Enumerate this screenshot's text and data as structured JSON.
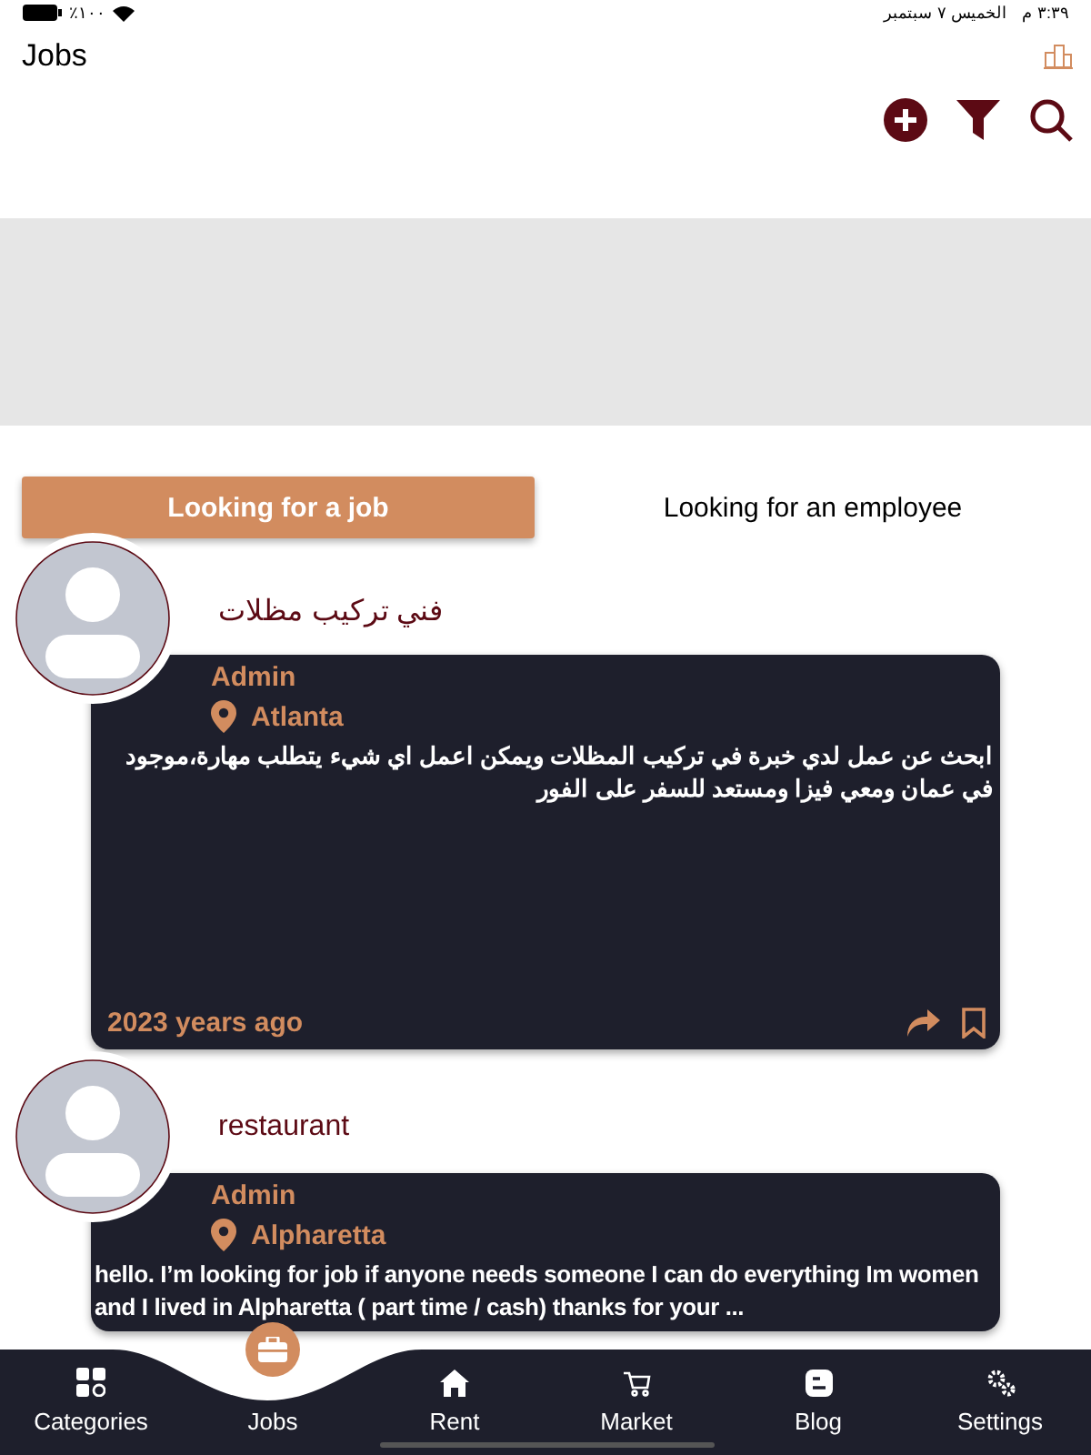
{
  "status_bar": {
    "battery": "٪١٠٠",
    "time": "٣:٣٩ م",
    "date": "الخميس ٧ سبتمبر"
  },
  "header": {
    "title": "Jobs"
  },
  "tabs": [
    {
      "label": "Looking for a job",
      "selected": true
    },
    {
      "label": "Looking for an employee",
      "selected": false
    }
  ],
  "posts": [
    {
      "title": "فني تركيب مظلات",
      "author": "Admin",
      "location": "Atlanta",
      "description": "ابحث عن عمل لدي خبرة في تركيب المظلات ويمكن اعمل اي شيء يتطلب مهارة،موجود في عمان ومعي فيزا ومستعد للسفر على الفور",
      "time": "2023 years ago"
    },
    {
      "title": "restaurant",
      "author": "Admin",
      "location": "Alpharetta",
      "description": "hello. I’m looking for job if anyone needs someone I can do everything Im women and I lived  in Alpharetta ( part time / cash) thanks for your ..."
    }
  ],
  "nav": [
    {
      "label": "Categories",
      "selected": false
    },
    {
      "label": "Jobs",
      "selected": true
    },
    {
      "label": "Rent",
      "selected": false
    },
    {
      "label": "Market",
      "selected": false
    },
    {
      "label": "Blog",
      "selected": false
    },
    {
      "label": "Settings",
      "selected": false
    }
  ]
}
